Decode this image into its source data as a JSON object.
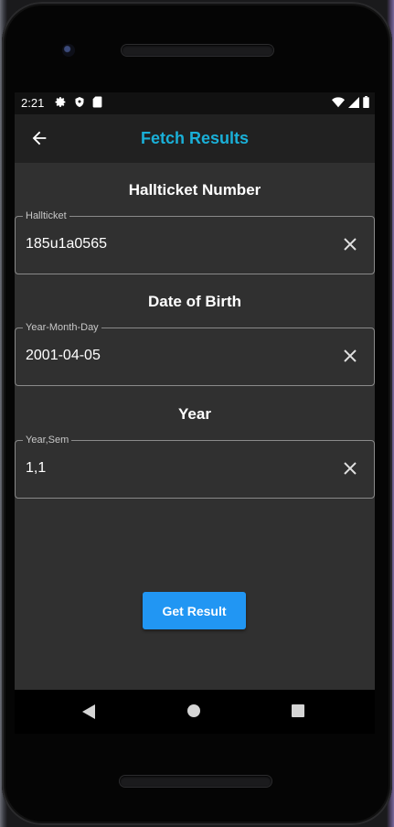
{
  "status_bar": {
    "time": "2:21",
    "left_icons": [
      "settings-icon",
      "shield-icon",
      "sd-card-icon"
    ],
    "right_icons": [
      "wifi-icon",
      "signal-icon",
      "battery-icon"
    ]
  },
  "app_bar": {
    "title": "Fetch Results",
    "back_icon": "arrow-back-icon"
  },
  "form": {
    "hallticket": {
      "section_label": "Hallticket Number",
      "legend": "Hallticket",
      "value": "185u1a0565"
    },
    "dob": {
      "section_label": "Date of Birth",
      "legend": "Year-Month-Day",
      "value": "2001-04-05"
    },
    "year": {
      "section_label": "Year",
      "legend": "Year,Sem",
      "value": "1,1"
    },
    "submit_label": "Get Result"
  },
  "nav_bar": {
    "back": "nav-back-icon",
    "home": "nav-home-icon",
    "recents": "nav-recents-icon"
  },
  "colors": {
    "accent_title": "#1ab0d8",
    "button": "#2196f3",
    "background": "#303030",
    "app_bar": "#212121"
  }
}
